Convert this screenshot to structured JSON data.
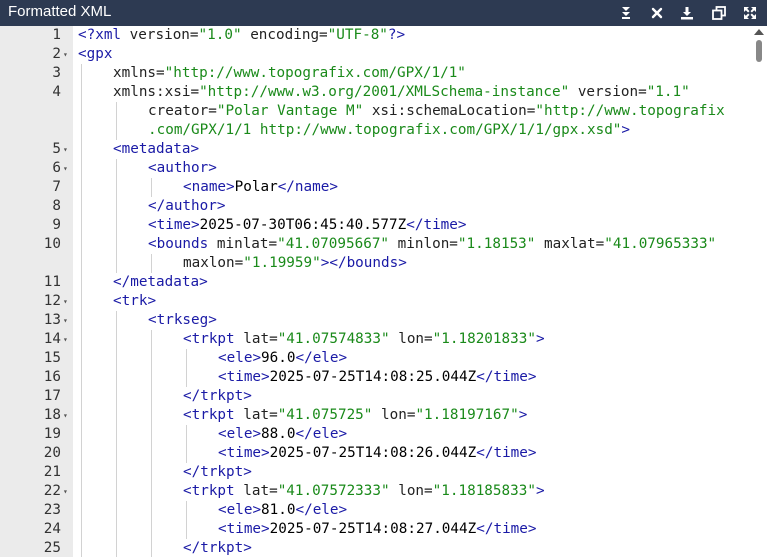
{
  "window": {
    "title": "Formatted XML"
  },
  "toolbar": [
    {
      "icon": "collapse-icon"
    },
    {
      "icon": "close-icon"
    },
    {
      "icon": "download-icon"
    },
    {
      "icon": "copy-icon"
    },
    {
      "icon": "fullscreen-icon"
    }
  ],
  "colors": {
    "titlebar": "#2d3a52",
    "tag": "#1a1aa6",
    "attr_value": "#1a8a1a",
    "gutter": "#ebebeb"
  },
  "lines": [
    {
      "n": "1",
      "fold": false,
      "indent": 0,
      "segs": [
        [
          "pi",
          "<?"
        ],
        [
          "tn",
          "xml"
        ],
        [
          "tx",
          " "
        ],
        [
          "an",
          "version="
        ],
        [
          "av",
          "\"1.0\""
        ],
        [
          "tx",
          " "
        ],
        [
          "an",
          "encoding="
        ],
        [
          "av",
          "\"UTF-8\""
        ],
        [
          "pi",
          "?>"
        ]
      ]
    },
    {
      "n": "2",
      "fold": true,
      "indent": 0,
      "segs": [
        [
          "tag",
          "<"
        ],
        [
          "tn",
          "gpx"
        ]
      ]
    },
    {
      "n": "3",
      "fold": false,
      "indent": 1,
      "segs": [
        [
          "an",
          "xmlns="
        ],
        [
          "av",
          "\"http://www.topografix.com/GPX/1/1\""
        ]
      ]
    },
    {
      "n": "4",
      "fold": false,
      "indent": 1,
      "segs": [
        [
          "an",
          "xmlns:xsi="
        ],
        [
          "av",
          "\"http://www.w3.org/2001/XMLSchema-instance\""
        ],
        [
          "tx",
          " "
        ],
        [
          "an",
          "version="
        ],
        [
          "av",
          "\"1.1\""
        ]
      ]
    },
    {
      "n": "",
      "fold": false,
      "indent": 2,
      "segs": [
        [
          "an",
          "creator="
        ],
        [
          "av",
          "\"Polar Vantage M\""
        ],
        [
          "tx",
          " "
        ],
        [
          "an",
          "xsi:schemaLocation="
        ],
        [
          "av",
          "\"http://www.topografix"
        ]
      ]
    },
    {
      "n": "",
      "fold": false,
      "indent": 2,
      "segs": [
        [
          "av",
          ".com/GPX/1/1 http://www.topografix.com/GPX/1/1/gpx.xsd\""
        ],
        [
          "tag",
          ">"
        ]
      ]
    },
    {
      "n": "5",
      "fold": true,
      "indent": 1,
      "segs": [
        [
          "tag",
          "<"
        ],
        [
          "tn",
          "metadata"
        ],
        [
          "tag",
          ">"
        ]
      ]
    },
    {
      "n": "6",
      "fold": true,
      "indent": 2,
      "segs": [
        [
          "tag",
          "<"
        ],
        [
          "tn",
          "author"
        ],
        [
          "tag",
          ">"
        ]
      ]
    },
    {
      "n": "7",
      "fold": false,
      "indent": 3,
      "segs": [
        [
          "tag",
          "<"
        ],
        [
          "tn",
          "name"
        ],
        [
          "tag",
          ">"
        ],
        [
          "tx",
          "Polar"
        ],
        [
          "tag",
          "</"
        ],
        [
          "tn",
          "name"
        ],
        [
          "tag",
          ">"
        ]
      ]
    },
    {
      "n": "8",
      "fold": false,
      "indent": 2,
      "segs": [
        [
          "tag",
          "</"
        ],
        [
          "tn",
          "author"
        ],
        [
          "tag",
          ">"
        ]
      ]
    },
    {
      "n": "9",
      "fold": false,
      "indent": 2,
      "segs": [
        [
          "tag",
          "<"
        ],
        [
          "tn",
          "time"
        ],
        [
          "tag",
          ">"
        ],
        [
          "tx",
          "2025-07-30T06:45:40.577Z"
        ],
        [
          "tag",
          "</"
        ],
        [
          "tn",
          "time"
        ],
        [
          "tag",
          ">"
        ]
      ]
    },
    {
      "n": "10",
      "fold": false,
      "indent": 2,
      "segs": [
        [
          "tag",
          "<"
        ],
        [
          "tn",
          "bounds"
        ],
        [
          "tx",
          " "
        ],
        [
          "an",
          "minlat="
        ],
        [
          "av",
          "\"41.07095667\""
        ],
        [
          "tx",
          " "
        ],
        [
          "an",
          "minlon="
        ],
        [
          "av",
          "\"1.18153\""
        ],
        [
          "tx",
          " "
        ],
        [
          "an",
          "maxlat="
        ],
        [
          "av",
          "\"41.07965333\""
        ]
      ]
    },
    {
      "n": "",
      "fold": false,
      "indent": 3,
      "segs": [
        [
          "an",
          "maxlon="
        ],
        [
          "av",
          "\"1.19959\""
        ],
        [
          "tag",
          "></"
        ],
        [
          "tn",
          "bounds"
        ],
        [
          "tag",
          ">"
        ]
      ]
    },
    {
      "n": "11",
      "fold": false,
      "indent": 1,
      "segs": [
        [
          "tag",
          "</"
        ],
        [
          "tn",
          "metadata"
        ],
        [
          "tag",
          ">"
        ]
      ]
    },
    {
      "n": "12",
      "fold": true,
      "indent": 1,
      "segs": [
        [
          "tag",
          "<"
        ],
        [
          "tn",
          "trk"
        ],
        [
          "tag",
          ">"
        ]
      ]
    },
    {
      "n": "13",
      "fold": true,
      "indent": 2,
      "segs": [
        [
          "tag",
          "<"
        ],
        [
          "tn",
          "trkseg"
        ],
        [
          "tag",
          ">"
        ]
      ]
    },
    {
      "n": "14",
      "fold": true,
      "indent": 3,
      "segs": [
        [
          "tag",
          "<"
        ],
        [
          "tn",
          "trkpt"
        ],
        [
          "tx",
          " "
        ],
        [
          "an",
          "lat="
        ],
        [
          "av",
          "\"41.07574833\""
        ],
        [
          "tx",
          " "
        ],
        [
          "an",
          "lon="
        ],
        [
          "av",
          "\"1.18201833\""
        ],
        [
          "tag",
          ">"
        ]
      ]
    },
    {
      "n": "15",
      "fold": false,
      "indent": 4,
      "segs": [
        [
          "tag",
          "<"
        ],
        [
          "tn",
          "ele"
        ],
        [
          "tag",
          ">"
        ],
        [
          "tx",
          "96.0"
        ],
        [
          "tag",
          "</"
        ],
        [
          "tn",
          "ele"
        ],
        [
          "tag",
          ">"
        ]
      ]
    },
    {
      "n": "16",
      "fold": false,
      "indent": 4,
      "segs": [
        [
          "tag",
          "<"
        ],
        [
          "tn",
          "time"
        ],
        [
          "tag",
          ">"
        ],
        [
          "tx",
          "2025-07-25T14:08:25.044Z"
        ],
        [
          "tag",
          "</"
        ],
        [
          "tn",
          "time"
        ],
        [
          "tag",
          ">"
        ]
      ]
    },
    {
      "n": "17",
      "fold": false,
      "indent": 3,
      "segs": [
        [
          "tag",
          "</"
        ],
        [
          "tn",
          "trkpt"
        ],
        [
          "tag",
          ">"
        ]
      ]
    },
    {
      "n": "18",
      "fold": true,
      "indent": 3,
      "segs": [
        [
          "tag",
          "<"
        ],
        [
          "tn",
          "trkpt"
        ],
        [
          "tx",
          " "
        ],
        [
          "an",
          "lat="
        ],
        [
          "av",
          "\"41.075725\""
        ],
        [
          "tx",
          " "
        ],
        [
          "an",
          "lon="
        ],
        [
          "av",
          "\"1.18197167\""
        ],
        [
          "tag",
          ">"
        ]
      ]
    },
    {
      "n": "19",
      "fold": false,
      "indent": 4,
      "segs": [
        [
          "tag",
          "<"
        ],
        [
          "tn",
          "ele"
        ],
        [
          "tag",
          ">"
        ],
        [
          "tx",
          "88.0"
        ],
        [
          "tag",
          "</"
        ],
        [
          "tn",
          "ele"
        ],
        [
          "tag",
          ">"
        ]
      ]
    },
    {
      "n": "20",
      "fold": false,
      "indent": 4,
      "segs": [
        [
          "tag",
          "<"
        ],
        [
          "tn",
          "time"
        ],
        [
          "tag",
          ">"
        ],
        [
          "tx",
          "2025-07-25T14:08:26.044Z"
        ],
        [
          "tag",
          "</"
        ],
        [
          "tn",
          "time"
        ],
        [
          "tag",
          ">"
        ]
      ]
    },
    {
      "n": "21",
      "fold": false,
      "indent": 3,
      "segs": [
        [
          "tag",
          "</"
        ],
        [
          "tn",
          "trkpt"
        ],
        [
          "tag",
          ">"
        ]
      ]
    },
    {
      "n": "22",
      "fold": true,
      "indent": 3,
      "segs": [
        [
          "tag",
          "<"
        ],
        [
          "tn",
          "trkpt"
        ],
        [
          "tx",
          " "
        ],
        [
          "an",
          "lat="
        ],
        [
          "av",
          "\"41.07572333\""
        ],
        [
          "tx",
          " "
        ],
        [
          "an",
          "lon="
        ],
        [
          "av",
          "\"1.18185833\""
        ],
        [
          "tag",
          ">"
        ]
      ]
    },
    {
      "n": "23",
      "fold": false,
      "indent": 4,
      "segs": [
        [
          "tag",
          "<"
        ],
        [
          "tn",
          "ele"
        ],
        [
          "tag",
          ">"
        ],
        [
          "tx",
          "81.0"
        ],
        [
          "tag",
          "</"
        ],
        [
          "tn",
          "ele"
        ],
        [
          "tag",
          ">"
        ]
      ]
    },
    {
      "n": "24",
      "fold": false,
      "indent": 4,
      "segs": [
        [
          "tag",
          "<"
        ],
        [
          "tn",
          "time"
        ],
        [
          "tag",
          ">"
        ],
        [
          "tx",
          "2025-07-25T14:08:27.044Z"
        ],
        [
          "tag",
          "</"
        ],
        [
          "tn",
          "time"
        ],
        [
          "tag",
          ">"
        ]
      ]
    },
    {
      "n": "25",
      "fold": false,
      "indent": 3,
      "segs": [
        [
          "tag",
          "</"
        ],
        [
          "tn",
          "trkpt"
        ],
        [
          "tag",
          ">"
        ]
      ]
    }
  ]
}
